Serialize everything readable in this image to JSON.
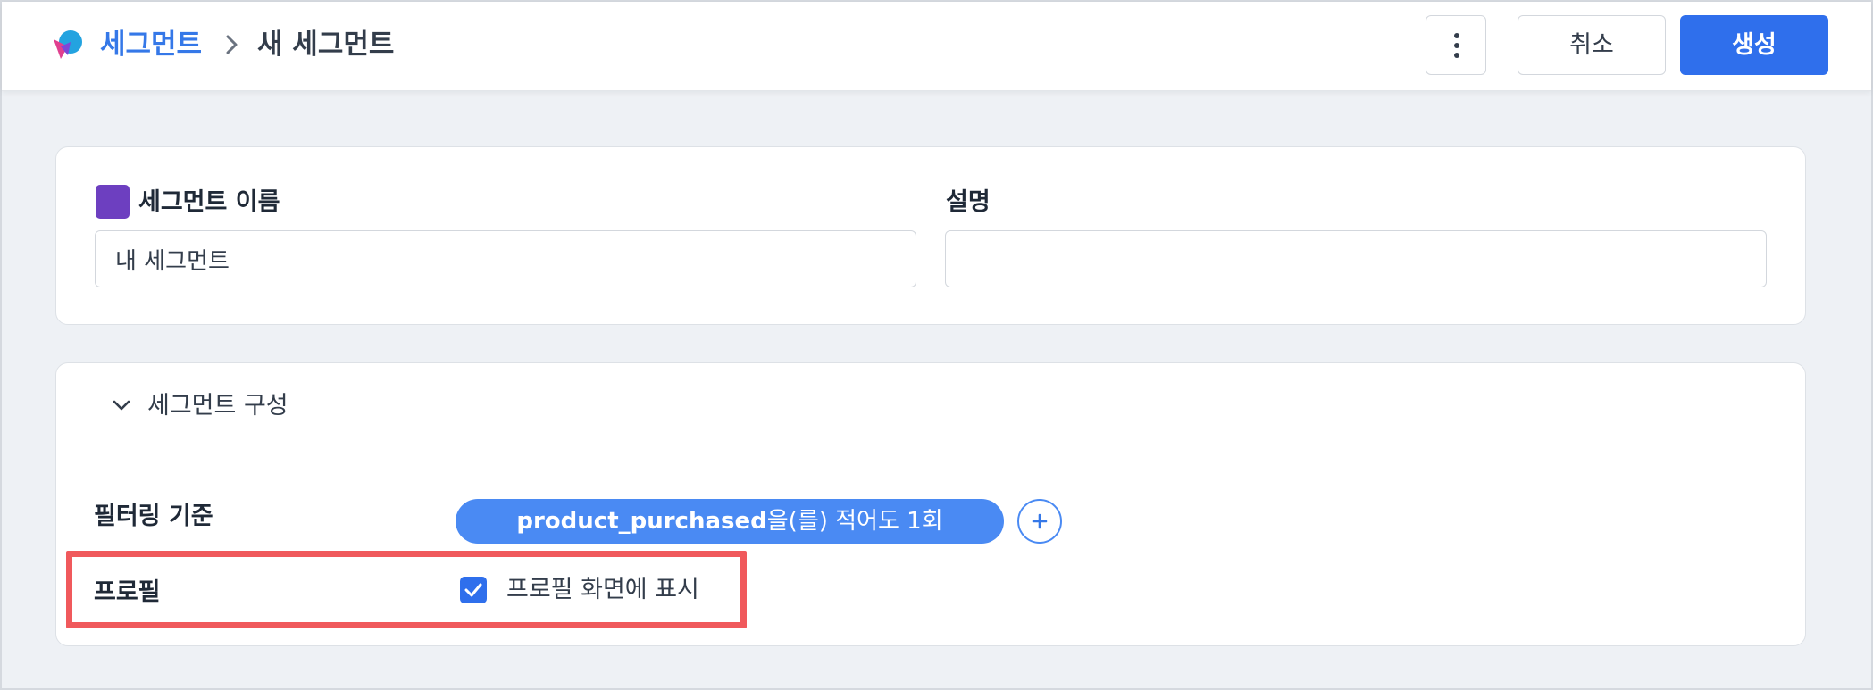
{
  "header": {
    "breadcrumb_root": "세그먼트",
    "breadcrumb_current": "새 세그먼트",
    "cancel_label": "취소",
    "create_label": "생성"
  },
  "segment_form": {
    "name_label": "세그먼트 이름",
    "name_value": "내 세그먼트",
    "segment_color": "#6d3fc0",
    "description_label": "설명",
    "description_value": ""
  },
  "segment_config": {
    "section_title": "세그먼트 구성",
    "filter_label": "필터링 기준",
    "filter_event": "product_purchased",
    "filter_condition": "을(를) 적어도 1회",
    "profile_label": "프로필",
    "profile_checkbox_label": "프로필 화면에 표시",
    "profile_checked": true
  },
  "colors": {
    "accent": "#2f6fec",
    "pill": "#4a8af3",
    "highlight": "#f0595c"
  }
}
